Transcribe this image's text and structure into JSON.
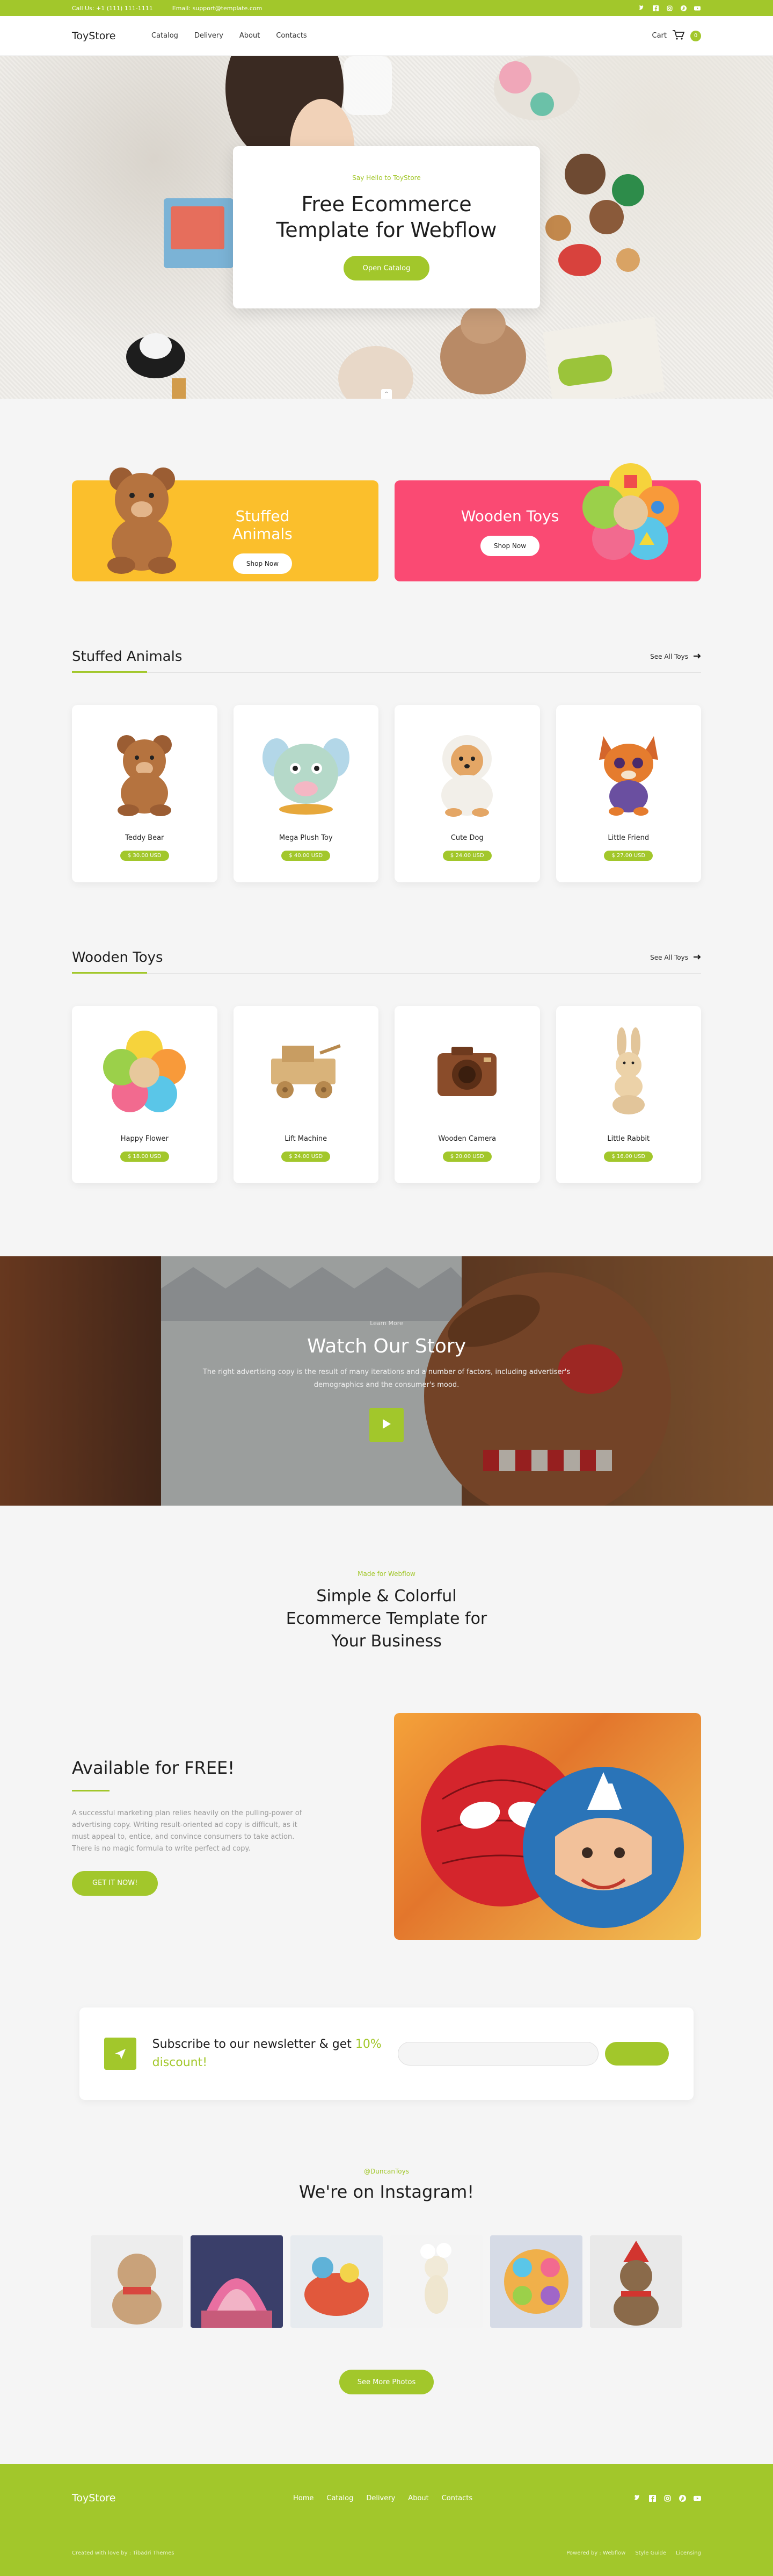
{
  "colors": {
    "accent": "#a2c72b",
    "yellow": "#fbbf2c",
    "pink": "#fa4a73",
    "background": "#f5f5f5"
  },
  "topbar": {
    "phone": "Call Us: +1 (111) 111-1111",
    "email": "Email: support@template.com",
    "social_icons": [
      "twitter-icon",
      "facebook-icon",
      "instagram-icon",
      "pinterest-icon",
      "youtube-icon"
    ]
  },
  "nav": {
    "logo": "ToyStore",
    "items": [
      {
        "label": "Catalog"
      },
      {
        "label": "Delivery"
      },
      {
        "label": "About"
      },
      {
        "label": "Contacts"
      }
    ],
    "cart_label": "Cart",
    "cart_count": "0"
  },
  "hero": {
    "eyebrow": "Say Hello to ToyStore",
    "title": "Free Ecommerce Template for Webflow",
    "button": "Open Catalog"
  },
  "promos": [
    {
      "title": "Stuffed Animals",
      "button": "Shop Now"
    },
    {
      "title": "Wooden Toys",
      "button": "Shop Now"
    }
  ],
  "stuffed": {
    "title": "Stuffed Animals",
    "see_all": "See All Toys",
    "products": [
      {
        "name": "Teddy Bear",
        "price": "$ 30.00 USD",
        "icon": "teddy-bear"
      },
      {
        "name": "Mega Plush Toy",
        "price": "$ 40.00 USD",
        "icon": "plush-toy"
      },
      {
        "name": "Cute Dog",
        "price": "$ 24.00 USD",
        "icon": "dog"
      },
      {
        "name": "Little Friend",
        "price": "$ 27.00 USD",
        "icon": "fox"
      }
    ]
  },
  "wooden": {
    "title": "Wooden Toys",
    "see_all": "See All Toys",
    "products": [
      {
        "name": "Happy Flower",
        "price": "$ 18.00 USD",
        "icon": "flower-puzzle"
      },
      {
        "name": "Lift Machine",
        "price": "$ 24.00 USD",
        "icon": "truck"
      },
      {
        "name": "Wooden Camera",
        "price": "$ 20.00 USD",
        "icon": "camera"
      },
      {
        "name": "Little Rabbit",
        "price": "$ 16.00 USD",
        "icon": "rabbit"
      }
    ]
  },
  "story": {
    "eyebrow": "Learn More",
    "title": "Watch Our Story",
    "text": "The right advertising copy is the result of many iterations and a number of factors, including advertiser's demographics and the consumer's mood."
  },
  "made": {
    "eyebrow": "Made for Webflow",
    "title": "Simple & Colorful Ecommerce Template for Your Business"
  },
  "free": {
    "title": "Available for FREE!",
    "text": "A successful marketing plan relies heavily on the pulling-power of advertising copy. Writing result-oriented ad copy is difficult, as it must appeal to, entice, and convince consumers to take action. There is no magic formula to write perfect ad copy.",
    "button": "GET IT NOW!"
  },
  "newsletter": {
    "text_main": "Subscribe to our newsletter & get",
    "text_highlight": "10% discount!",
    "input_placeholder": "",
    "button": ""
  },
  "instagram": {
    "eyebrow": "@DuncanToys",
    "title": "We're on Instagram!",
    "button": "See More Photos"
  },
  "footer": {
    "logo": "ToyStore",
    "items": [
      {
        "label": "Home"
      },
      {
        "label": "Catalog"
      },
      {
        "label": "Delivery"
      },
      {
        "label": "About"
      },
      {
        "label": "Contacts"
      }
    ],
    "credit": "Created with love by : Tibadri Themes",
    "bottom_links": [
      {
        "label": "Powered by : Webflow"
      },
      {
        "label": "Style Guide"
      },
      {
        "label": "Licensing"
      }
    ]
  }
}
